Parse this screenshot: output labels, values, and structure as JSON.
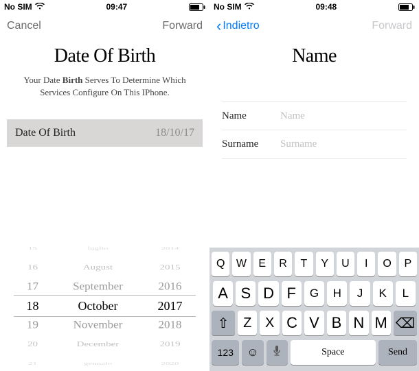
{
  "left": {
    "status": {
      "carrier": "No SIM",
      "time": "09:47"
    },
    "nav": {
      "cancel": "Cancel",
      "forward": "Forward"
    },
    "title": "Date Of Birth",
    "subtitle_pre": "Your Date ",
    "subtitle_bold": "Birth",
    "subtitle_post": " Serves To Determine Which Services Configure On This IPhone.",
    "dob_label": "Date Of Birth",
    "dob_value": "18/10/17",
    "picker": {
      "days": [
        "15",
        "16",
        "17",
        "18",
        "19",
        "20",
        "21"
      ],
      "months": [
        "luglio",
        "August",
        "September",
        "October",
        "November",
        "December",
        "gennaio"
      ],
      "years": [
        "2014",
        "2015",
        "2016",
        "2017",
        "2018",
        "2019",
        "2020"
      ]
    }
  },
  "right": {
    "status": {
      "carrier": "No SIM",
      "time": "09:48"
    },
    "nav": {
      "back": "Indietro",
      "forward": "Forward"
    },
    "title": "Name",
    "form": {
      "name_label": "Name",
      "name_placeholder": "Name",
      "surname_label": "Surname",
      "surname_placeholder": "Surname"
    },
    "keyboard": {
      "row1": [
        "Q",
        "W",
        "E",
        "R",
        "T",
        "Y",
        "U",
        "I",
        "O",
        "P"
      ],
      "row2_big": [
        "A",
        "S",
        "D",
        "F"
      ],
      "row2_small": [
        "G",
        "H",
        "J",
        "K",
        "L"
      ],
      "row3_left": "⇧",
      "row3_mid_small": [
        "Z",
        "X"
      ],
      "row3_mid_big": [
        "C",
        "V",
        "B",
        "N",
        "M"
      ],
      "row3_right": "⌫",
      "row4": {
        "num": "123",
        "emoji": "☺",
        "mic": "🎤",
        "space": "Space",
        "send": "Send"
      }
    }
  }
}
